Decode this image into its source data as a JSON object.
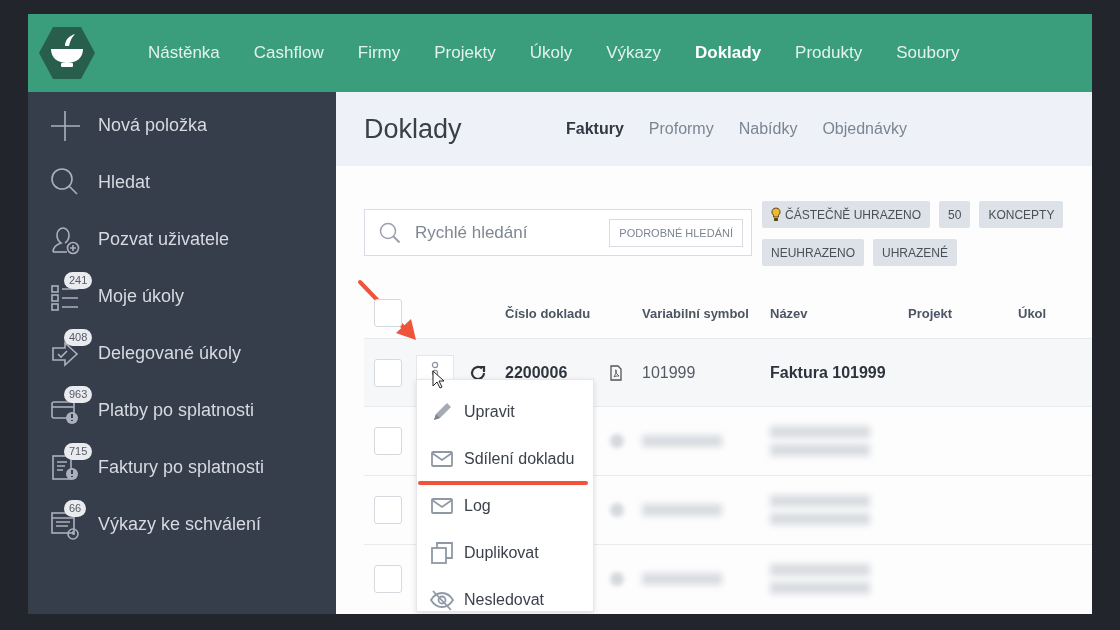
{
  "nav": {
    "items": [
      {
        "label": "Nástěnka",
        "selected": false
      },
      {
        "label": "Cashflow",
        "selected": false
      },
      {
        "label": "Firmy",
        "selected": false
      },
      {
        "label": "Projekty",
        "selected": false
      },
      {
        "label": "Úkoly",
        "selected": false
      },
      {
        "label": "Výkazy",
        "selected": false
      },
      {
        "label": "Doklady",
        "selected": true
      },
      {
        "label": "Produkty",
        "selected": false
      },
      {
        "label": "Soubory",
        "selected": false
      }
    ]
  },
  "sidebar": {
    "items": [
      {
        "kind": "plus",
        "label": "Nová položka"
      },
      {
        "kind": "search",
        "label": "Hledat"
      },
      {
        "kind": "user-add",
        "label": "Pozvat uživatele"
      },
      {
        "kind": "checklist",
        "label": "Moje úkoly",
        "badge": "241"
      },
      {
        "kind": "delegate",
        "label": "Delegované úkoly",
        "badge": "408"
      },
      {
        "kind": "card-alert",
        "label": "Platby po splatnosti",
        "badge": "963"
      },
      {
        "kind": "doc-alert",
        "label": "Faktury po splatnosti",
        "badge": "715"
      },
      {
        "kind": "doc-clock",
        "label": "Výkazy ke schválení",
        "badge": "66"
      }
    ]
  },
  "page": {
    "title": "Doklady",
    "tabs": [
      {
        "label": "Faktury",
        "selected": true
      },
      {
        "label": "Proformy",
        "selected": false
      },
      {
        "label": "Nabídky",
        "selected": false
      },
      {
        "label": "Objednávky",
        "selected": false
      }
    ]
  },
  "search": {
    "placeholder": "Rychlé hledání",
    "button": "PODROBNÉ HLEDÁNÍ"
  },
  "filters": [
    [
      {
        "label": "ČÁSTEČNĚ UHRAZENO",
        "kind": "bulb"
      },
      {
        "label": "50",
        "kind": "plain"
      },
      {
        "label": "KONCEPTY",
        "kind": "plain"
      }
    ],
    [
      {
        "label": "NEUHRAZENO",
        "kind": "plain"
      },
      {
        "label": "UHRAZENÉ",
        "kind": "plain"
      }
    ]
  ],
  "table": {
    "all_checked": false,
    "columns": [
      "Číslo dokladu",
      "Variabilní symbol",
      "Název",
      "Projekt",
      "Úkol"
    ],
    "rows": [
      {
        "kind": "data",
        "checked": false,
        "number": "2200006",
        "symbol": "101999",
        "name": "Faktura 101999"
      },
      {
        "kind": "blurred",
        "checked": false
      },
      {
        "kind": "blurred",
        "checked": false
      },
      {
        "kind": "blurred",
        "checked": false
      }
    ]
  },
  "menu": {
    "items": [
      {
        "kind": "edit",
        "label": "Upravit",
        "underlined": false
      },
      {
        "kind": "mail",
        "label": "Sdílení dokladu",
        "underlined": true
      },
      {
        "kind": "mail",
        "label": "Log",
        "underlined": false
      },
      {
        "kind": "copy",
        "label": "Duplikovat",
        "underlined": false
      },
      {
        "kind": "hide",
        "label": "Nesledovat",
        "underlined": false
      }
    ]
  }
}
